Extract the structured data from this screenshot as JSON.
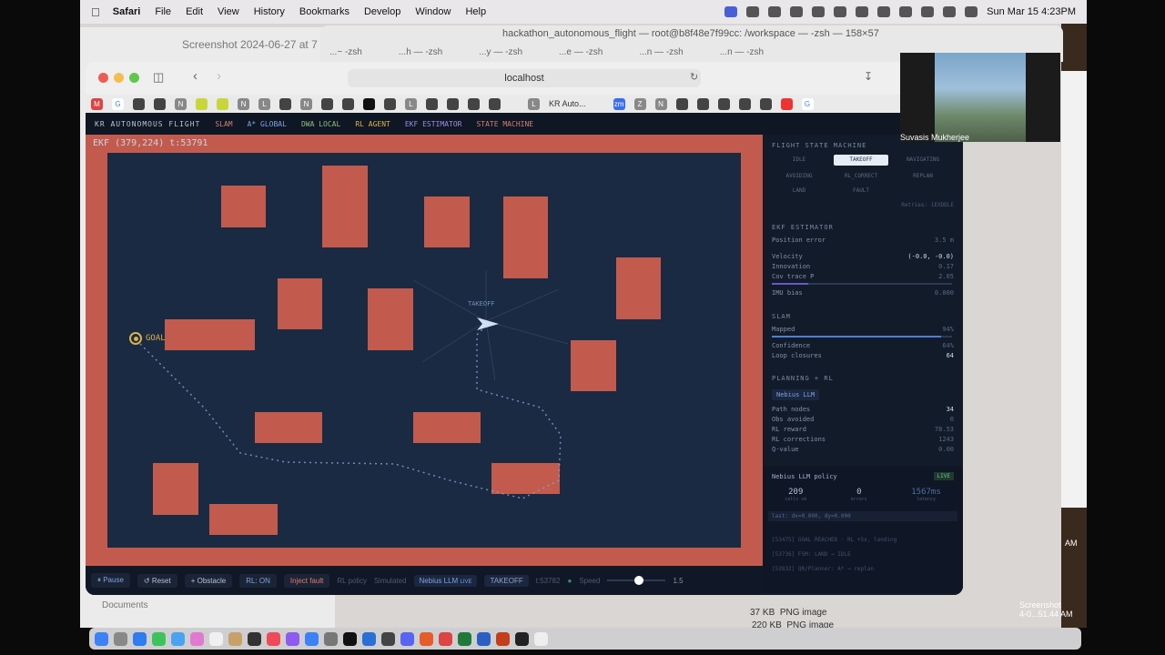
{
  "menubar": {
    "app": "Safari",
    "items": [
      "File",
      "Edit",
      "View",
      "History",
      "Bookmarks",
      "Develop",
      "Window",
      "Help"
    ],
    "clock": "Sun Mar 15  4:23PM"
  },
  "background": {
    "finder_title": "Screenshot 2024-06-27 at 7",
    "terminal_title": "hackathon_autonomous_flight — root@b8f48e7f99cc: /workspace — -zsh — 158×57",
    "terminal_tabs": [
      "...~ -zsh",
      "...h — -zsh",
      "...y — -zsh",
      "...e — -zsh",
      "...n — -zsh",
      "...n — -zsh"
    ],
    "documents_label": "Documents",
    "downloads": [
      {
        "size": "37 KB",
        "kind": "PNG image"
      },
      {
        "size": "220 KB",
        "kind": "PNG image"
      }
    ],
    "screenshot_label": "Screenshot",
    "screenshot_time": "4-0...51.44 AM",
    "am_label": "AM"
  },
  "safari": {
    "url": "localhost",
    "tab_label": "KR Auto..."
  },
  "webcam": {
    "name": "Suvasis Mukherjee"
  },
  "app": {
    "brand": "KR AUTONOMOUS FLIGHT",
    "nav": [
      "SLAM",
      "A* GLOBAL",
      "DWA LOCAL",
      "RL AGENT",
      "EKF ESTIMATOR",
      "STATE MACHINE"
    ],
    "ekf_readout": "EKF (379,224)  t:53791",
    "goal_label": "GOAL",
    "drone_state": "TAKEOFF",
    "controls": {
      "pause": "⏸ Pause",
      "reset": "↺ Reset",
      "obstacle": "+ Obstacle",
      "rl": "RL: ON",
      "fault": "Inject fault",
      "rl_policy": "RL policy",
      "simulated": "Simulated",
      "nebius": "Nebius LLM",
      "live": "LIVE",
      "state": "TAKEOFF",
      "tick": "t:53782",
      "speed_label": "Speed",
      "speed_value": "1.5"
    },
    "panel": {
      "fsm_title": "FLIGHT STATE MACHINE",
      "states": [
        "IDLE",
        "TAKEOFF",
        "NAVIGATING",
        "AVOIDING",
        "RL_CORRECT",
        "REPLAN",
        "LAND",
        "FAULT"
      ],
      "active_state": "TAKEOFF",
      "retries": "Retries: 1EXDDLE",
      "ekf_title": "EKF ESTIMATOR",
      "ekf_rows": [
        {
          "k": "Position error",
          "v": "3.5 m"
        },
        {
          "k": "Velocity",
          "v": "(-0.0, -0.0)"
        },
        {
          "k": "Innovation",
          "v": "0.17"
        },
        {
          "k": "Cov trace P",
          "v": "2.05"
        },
        {
          "k": "IMU bias",
          "v": "0.000"
        }
      ],
      "slam_title": "SLAM",
      "slam_rows": [
        {
          "k": "Mapped",
          "v": "94%"
        },
        {
          "k": "Confidence",
          "v": "64%"
        },
        {
          "k": "Loop closures",
          "v": "64"
        }
      ],
      "planning_title": "PLANNING + RL",
      "planner_badge": "Nebius LLM",
      "planning_rows": [
        {
          "k": "Path nodes",
          "v": "34"
        },
        {
          "k": "Obs avoided",
          "v": "0"
        },
        {
          "k": "RL reward",
          "v": "78.53"
        },
        {
          "k": "RL corrections",
          "v": "1243"
        },
        {
          "k": "Q-value",
          "v": "0.00"
        }
      ],
      "llm_title": "Nebius LLM policy",
      "llm_live": "LIVE",
      "llm_stats": [
        {
          "v": "209",
          "k": "calls ok"
        },
        {
          "v": "0",
          "k": "errors"
        },
        {
          "v": "1567ms",
          "k": "latency"
        }
      ],
      "last_cmd": "last: dx=0.000, dy=0.000",
      "log": [
        "[53475] GOAL REACHED · RL +5x, landing",
        "[53736] FSM: LAND → IDLE",
        "[53832] QR/Planner: A* → replan"
      ]
    }
  },
  "map_data": {
    "grid": [
      60,
      42
    ],
    "obstacles": [
      [
        12,
        5,
        4,
        4
      ],
      [
        21,
        3,
        4,
        8
      ],
      [
        30,
        6,
        4,
        5
      ],
      [
        37,
        6,
        4,
        8
      ],
      [
        47,
        12,
        4,
        6
      ],
      [
        17,
        14,
        4,
        5
      ],
      [
        25,
        15,
        4,
        6
      ],
      [
        7,
        18,
        8,
        3
      ],
      [
        43,
        20,
        4,
        5
      ],
      [
        15,
        27,
        6,
        3
      ],
      [
        29,
        27,
        6,
        3
      ],
      [
        6,
        32,
        4,
        5
      ],
      [
        36,
        32,
        6,
        3
      ],
      [
        11,
        36,
        6,
        3
      ]
    ]
  },
  "colors": {
    "wall": "#c25b4d",
    "map_bg": "#1a2a42",
    "accent": "#4d7fd1",
    "goal": "#d9b24a"
  }
}
